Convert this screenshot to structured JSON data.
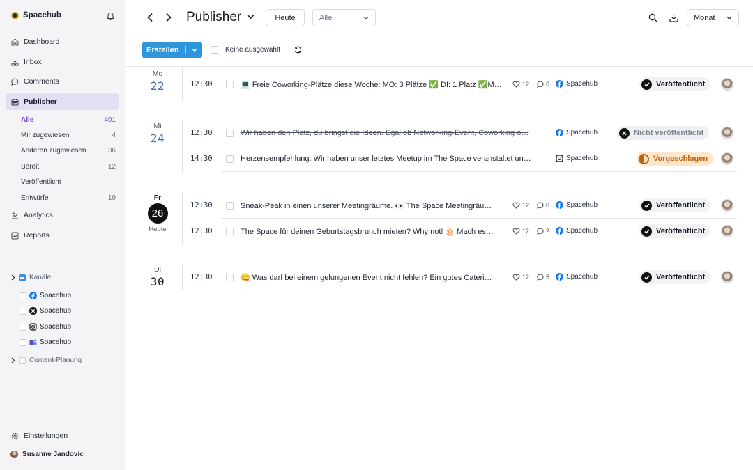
{
  "app": {
    "name": "Spacehub"
  },
  "sidebar": {
    "nav": [
      {
        "label": "Dashboard",
        "icon": "home-icon"
      },
      {
        "label": "Inbox",
        "icon": "inbox-icon"
      },
      {
        "label": "Comments",
        "icon": "comment-icon"
      },
      {
        "label": "Publisher",
        "icon": "calendar-icon",
        "active": true
      },
      {
        "label": "Analytics",
        "icon": "analytics-icon"
      },
      {
        "label": "Reports",
        "icon": "reports-icon"
      }
    ],
    "publisher_sub": [
      {
        "label": "Alle",
        "count": "401",
        "active": true
      },
      {
        "label": "Mir zugewiesen",
        "count": "4"
      },
      {
        "label": "Anderen zugewiesen",
        "count": "36"
      },
      {
        "label": "Bereit",
        "count": "12"
      },
      {
        "label": "Veröffentlicht",
        "count": ""
      },
      {
        "label": "Entwürfe",
        "count": "19"
      }
    ],
    "channels_group": "Kanäle",
    "channels": [
      {
        "label": "Spacehub",
        "icon": "facebook-icon"
      },
      {
        "label": "Spacehub",
        "icon": "x-icon"
      },
      {
        "label": "Spacehub",
        "icon": "instagram-icon"
      },
      {
        "label": "Spacehub",
        "icon": "teams-icon"
      }
    ],
    "content_group": "Content-Planung",
    "settings": "Einstellungen",
    "user": "Susanne Jandovic"
  },
  "toolbar": {
    "title": "Publisher",
    "today_button": "Heute",
    "filter_value": "Alle",
    "view_value": "Monat",
    "create_button": "Erstellen",
    "select_label": "Keine ausgewählt"
  },
  "days": [
    {
      "dow": "Mo",
      "num": "22"
    },
    {
      "dow": "Mi",
      "num": "24"
    },
    {
      "dow": "Fr",
      "num": "26",
      "today_label": "Heute"
    },
    {
      "dow": "Di",
      "num": "30"
    }
  ],
  "posts": [
    {
      "time": "12:30",
      "text": "💻 Freie Coworking-Plätze diese Woche: MO: 3 Plätze ✅ DI: 1 Platz ✅M…",
      "likes": "12",
      "comments": "0",
      "channel": "Spacehub",
      "status": "Veröffentlicht"
    },
    {
      "time": "12:30",
      "text": "Wir haben den Platz, du bringst die Ideen. Egal ob Networking-Event, Coworking o…",
      "channel": "Spacehub",
      "status": "Nicht veröffentlicht"
    },
    {
      "time": "14:30",
      "text": "Herzensempfehlung: Wir haben unser letztes Meetup im The Space veranstaltet un…",
      "channel": "Spacehub",
      "status": "Vorgeschlagen"
    },
    {
      "time": "12:30",
      "text": "Sneak-Peak in einen unserer Meetingräume. 👀 The Space Meetingräu…",
      "likes": "12",
      "comments": "0",
      "channel": "Spacehub",
      "status": "Veröffentlicht"
    },
    {
      "time": "12:30",
      "text": "The Space für deinen Geburtstagsbrunch mieten? Why not! 🎂 Mach es…",
      "likes": "12",
      "comments": "2",
      "channel": "Spacehub",
      "status": "Veröffentlicht"
    },
    {
      "time": "12:30",
      "text": "😋 Was darf bei einem gelungenen Event nicht fehlen? Ein gutes Cateri…",
      "likes": "12",
      "comments": "5",
      "channel": "Spacehub",
      "status": "Veröffentlicht"
    }
  ],
  "colors": {
    "accent": "#2d96dd",
    "active_bg": "#e4def3",
    "active_text": "#7d3fc6",
    "proposed": "#c0620e"
  }
}
